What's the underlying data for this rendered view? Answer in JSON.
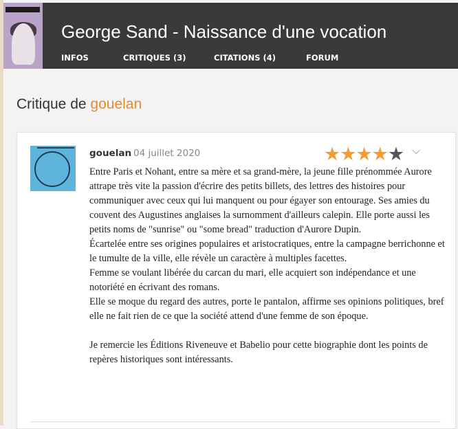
{
  "book": {
    "title": "George Sand - Naissance d'une vocation",
    "cover_small_title": "George\nSand"
  },
  "nav": {
    "items": [
      {
        "label": "INFOS"
      },
      {
        "label": "CRITIQUES (3)"
      },
      {
        "label": "CITATIONS (4)"
      },
      {
        "label": "FORUM"
      }
    ]
  },
  "page": {
    "heading_prefix": "Critique de",
    "heading_user": "gouelan"
  },
  "review": {
    "author": "gouelan",
    "date": "04 juillet 2020",
    "rating": 4,
    "rating_max": 5,
    "paragraphs": [
      "Entre Paris et Nohant, entre sa mère et sa grand-mère, la jeune fille prénommée Aurore attrape très vite la passion d'écrire des petits billets, des lettres des histoires pour communiquer avec ceux qui lui manquent ou pour égayer son entourage. Ses amies du couvent des Augustines anglaises la surnomment d'ailleurs calepin. Elle porte aussi les petits noms de \"sunrise\" ou \"some bread\" traduction d'Aurore Dupin.",
      "Écartelée entre ses origines populaires et aristocratiques, entre la campagne berrichonne et le tumulte de la ville, elle révèle un caractère à multiples facettes.",
      "Femme se voulant libérée du carcan du mari, elle acquiert son indépendance et une notoriété en écrivant des romans.",
      "Elle se moque du regard des autres, porte le pantalon, affirme ses opinions politiques, bref elle ne fait rien de ce que la société attend d'une femme de son époque.",
      "",
      "Je remercie les Éditions Riveneuve et Babelio pour cette biographie dont les points de repères historiques sont intéressants."
    ]
  },
  "colors": {
    "header_bg": "#3a3a3a",
    "accent": "#e88a2a",
    "star_on": "#f39c33",
    "star_off": "#555555"
  }
}
